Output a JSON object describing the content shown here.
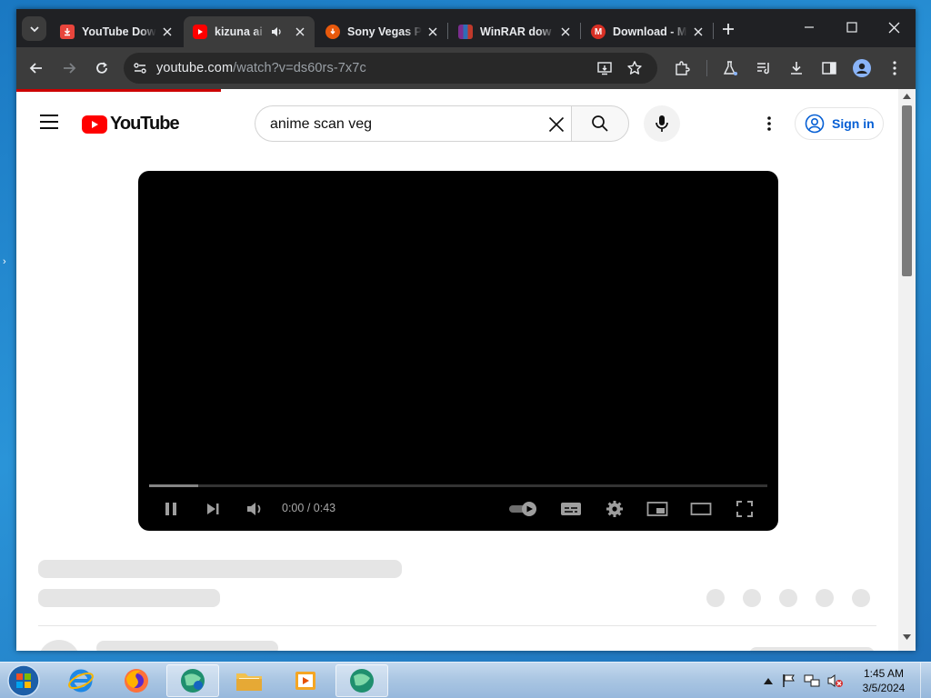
{
  "browser": {
    "tabs": [
      {
        "title": "YouTube Dow",
        "favicon": "download-icon",
        "color": "#e8453c",
        "active": false
      },
      {
        "title": "kizuna ai",
        "favicon": "youtube-icon",
        "color": "#ff0000",
        "active": true,
        "audio": true
      },
      {
        "title": "Sony Vegas P",
        "favicon": "download-circle-icon",
        "color": "#e8590c",
        "active": false
      },
      {
        "title": "WinRAR dow",
        "favicon": "winrar-icon",
        "color": "#8b2f8f",
        "active": false
      },
      {
        "title": "Download - M",
        "favicon": "m-icon",
        "color": "#d93025",
        "active": false
      }
    ],
    "url_host": "youtube.com",
    "url_path": "/watch?v=ds60rs-7x7c"
  },
  "youtube": {
    "logo_text": "YouTube",
    "search_value": "anime scan veg",
    "signin_label": "Sign in",
    "player": {
      "current_time": "0:00",
      "duration": "0:43",
      "loaded_fraction": 0.08
    }
  },
  "taskbar": {
    "time": "1:45 AM",
    "date": "3/5/2024"
  },
  "colors": {
    "accent": "#065fd4",
    "youtube_red": "#ff0000",
    "chrome_dark": "#202124"
  }
}
